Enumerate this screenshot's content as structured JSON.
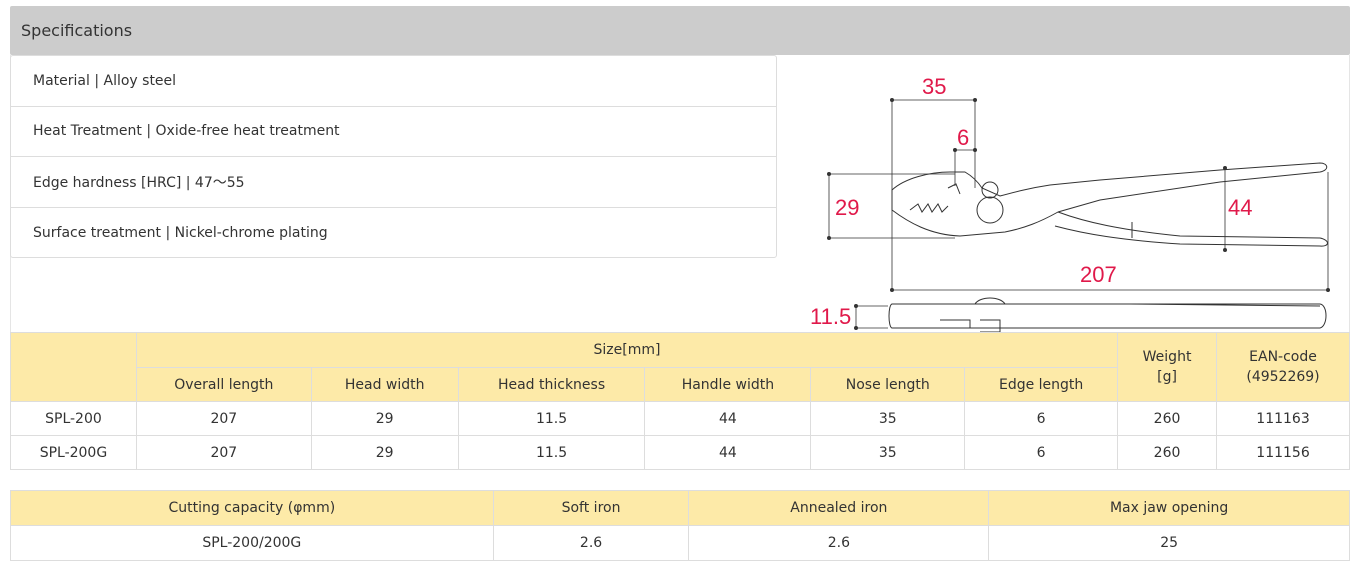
{
  "section": {
    "title": "Specifications"
  },
  "specs": [
    {
      "text": "Material | Alloy steel"
    },
    {
      "text": "Heat Treatment | Oxide-free heat treatment"
    },
    {
      "text": "Edge hardness [HRC] | 47～55"
    },
    {
      "text": "Surface treatment | Nickel-chrome plating"
    }
  ],
  "diagram": {
    "nose_length": "35",
    "edge_length": "6",
    "head_width": "29",
    "handle_width": "44",
    "overall_length": "207",
    "head_thickness": "11.5",
    "dimension_color": "#e0194a"
  },
  "size_table": {
    "group_header": "Size[mm]",
    "weight_header_line1": "Weight",
    "weight_header_line2": "[g]",
    "ean_header_line1": "EAN-code",
    "ean_header_line2": "(4952269)",
    "columns": [
      "Overall length",
      "Head width",
      "Head thickness",
      "Handle width",
      "Nose length",
      "Edge length"
    ],
    "rows": [
      {
        "model": "SPL-200",
        "values": [
          "207",
          "29",
          "11.5",
          "44",
          "35",
          "6"
        ],
        "weight": "260",
        "ean": "111163"
      },
      {
        "model": "SPL-200G",
        "values": [
          "207",
          "29",
          "11.5",
          "44",
          "35",
          "6"
        ],
        "weight": "260",
        "ean": "111156"
      }
    ]
  },
  "cut_table": {
    "headers": [
      "Cutting capacity (φmm)",
      "Soft iron",
      "Annealed iron",
      "Max jaw opening"
    ],
    "rows": [
      {
        "values": [
          "SPL-200/200G",
          "2.6",
          "2.6",
          "25"
        ]
      }
    ]
  },
  "colors": {
    "header_bg": "#cccccc",
    "table_header_bg": "#fdeaa8",
    "border": "#dddddd"
  }
}
